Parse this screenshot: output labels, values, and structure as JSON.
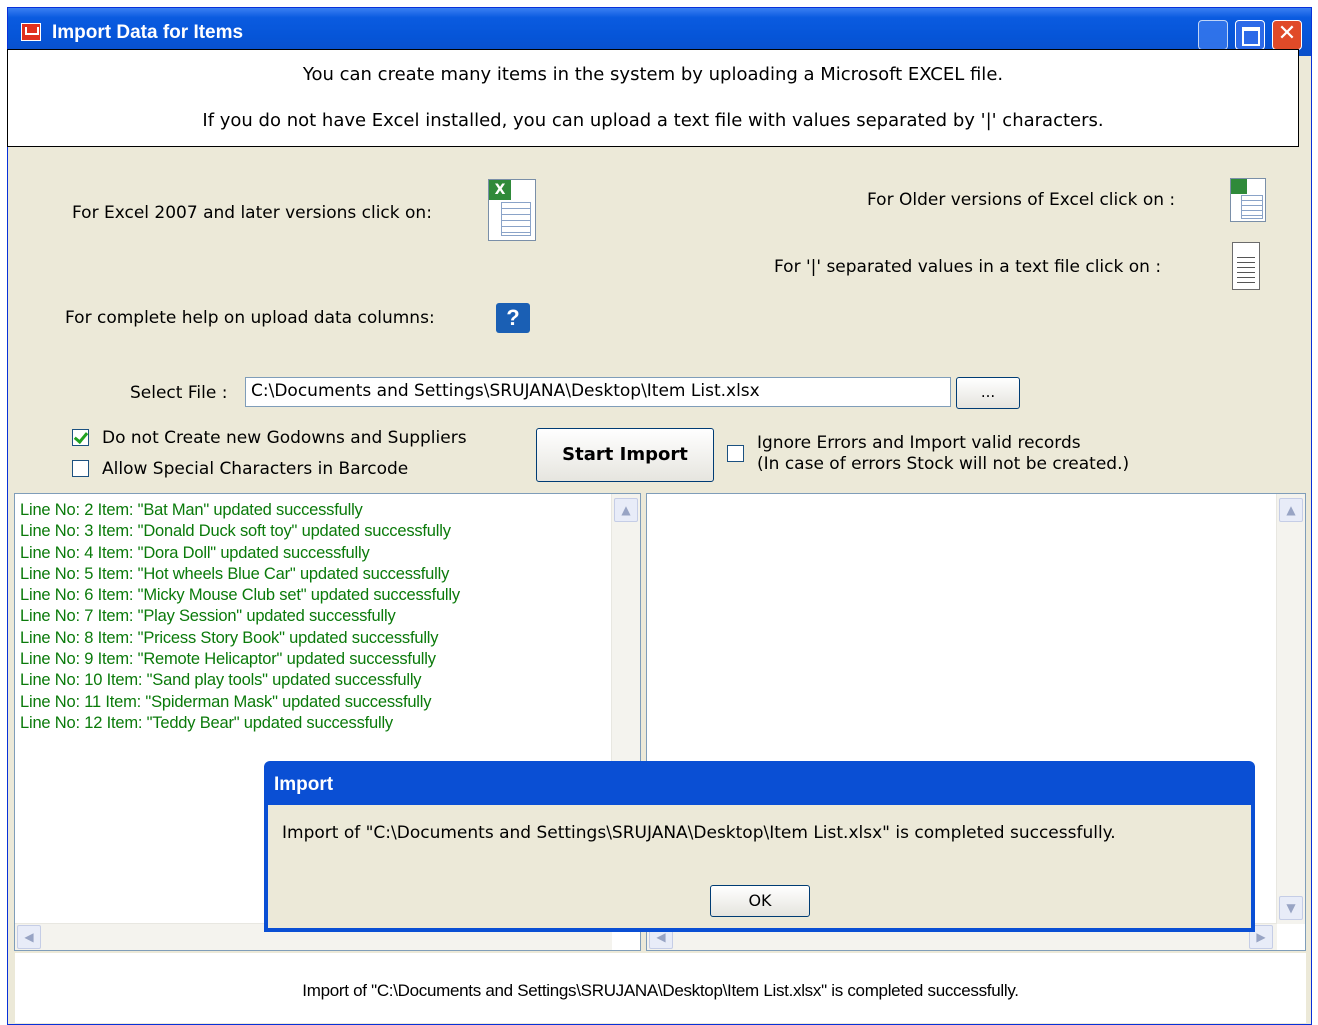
{
  "window": {
    "title": "Import Data for Items",
    "close_glyph": "✕"
  },
  "banner": {
    "line1": "You can create many items in the system by uploading a Microsoft EXCEL file.",
    "line2": "If you do not have Excel installed, you can upload a text file with values separated by '|' characters."
  },
  "options": {
    "excel2007_label": "For Excel 2007 and later versions click on:",
    "older_excel_label": "For Older versions of Excel click on :",
    "text_file_label": "For '|' separated  values in a text file click on :",
    "help_label": "For complete help on upload data columns:",
    "help_glyph": "?",
    "excel_glyph": "X"
  },
  "file": {
    "label": "Select File :",
    "path": "C:\\Documents and Settings\\SRUJANA\\Desktop\\Item List.xlsx",
    "browse_label": "..."
  },
  "checkboxes": {
    "no_create_godowns": {
      "label": "Do not Create new Godowns and Suppliers",
      "checked": true
    },
    "allow_special_chars": {
      "label": "Allow Special Characters in Barcode",
      "checked": false
    },
    "ignore_errors": {
      "label": "Ignore Errors and Import valid records",
      "note": "(In case of errors Stock will not be created.)",
      "checked": false
    }
  },
  "start_button": "Start Import",
  "log": {
    "color": "#0a7a0a",
    "lines": [
      "Line No: 2 Item: \"Bat Man\" updated successfully",
      "Line No: 3 Item: \"Donald Duck soft toy\" updated successfully",
      "Line No: 4 Item: \"Dora Doll\" updated successfully",
      "Line No: 5 Item: \"Hot wheels Blue Car\" updated successfully",
      "Line No: 6 Item: \"Micky Mouse Club set\" updated successfully",
      "Line No: 7 Item: \"Play Session\" updated successfully",
      "Line No: 8 Item: \"Pricess Story Book\" updated successfully",
      "Line No: 9 Item: \"Remote Helicaptor\" updated successfully",
      "Line No: 10 Item: \"Sand play tools\" updated successfully",
      "Line No: 11 Item: \"Spiderman Mask\" updated successfully",
      "Line No: 12 Item: \"Teddy Bear\" updated successfully"
    ]
  },
  "scroll": {
    "up": "▲",
    "down": "▼",
    "left": "◀",
    "right": "▶"
  },
  "status": "Import of \"C:\\Documents and Settings\\SRUJANA\\Desktop\\Item List.xlsx\" is completed successfully.",
  "dialog": {
    "title": "Import",
    "message": "Import of \"C:\\Documents and Settings\\SRUJANA\\Desktop\\Item List.xlsx\" is completed successfully.",
    "ok_label": "OK"
  }
}
